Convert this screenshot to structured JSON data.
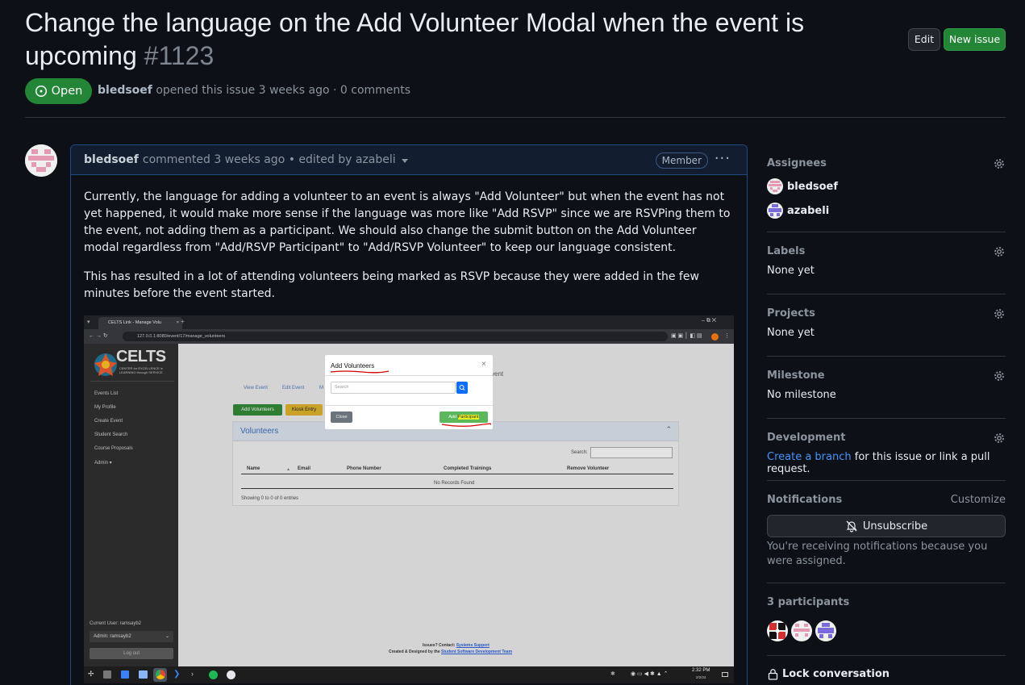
{
  "issue": {
    "title": "Change the language on the Add Volunteer Modal when the event is upcoming",
    "number": "#1123",
    "state": "Open",
    "author": "bledsoef",
    "opened_text": "opened this issue 3 weeks ago · 0 comments"
  },
  "header": {
    "edit_label": "Edit",
    "new_issue_label": "New issue"
  },
  "comment": {
    "author": "bledsoef",
    "meta": "commented 3 weeks ago • edited by azabeli",
    "badge": "Member",
    "menu": "···",
    "paragraphs": [
      "Currently, the language for adding a volunteer to an event is always \"Add Volunteer\" but when the event has not yet happened, it would make more sense if the language was more like \"Add RSVP\" since we are RSVPing them to the event, not adding them as a participant. We should also change the submit button on the Add Volunteer modal regardless from \"Add/RSVP Participant\" to \"Add/RSVP Volunteer\" to keep our language consistent.",
      "This has resulted in a lot of attending volunteers being marked as RSVP because they were added in the few minutes before the event started."
    ]
  },
  "screenshot": {
    "tab_title": "CELTS Link - Manage Volu",
    "url": "127.0.0.1:8080/event/17/manage_volunteers",
    "logo_text": "CELTS",
    "logo_sub": "CENTER for EXCELLENCE in LEARNING through SERVICE",
    "nav": [
      "Events List",
      "My Profile",
      "Create Event",
      "Student Search",
      "Course Proposals",
      "Admin ▾"
    ],
    "current_user": "Current User: ramsayb2",
    "admin_select": "Admin: ramsayb2",
    "logout": "Log out",
    "event_text": "vent",
    "links": [
      "View Event",
      "Edit Event",
      "M"
    ],
    "add_volunteers_btn": "Add Volunteers",
    "kiosk_btn": "Kiosk Entry",
    "panel_title": "Volunteers",
    "search_label": "Search:",
    "columns": [
      "Name",
      "Email",
      "Phone Number",
      "Completed Trainings",
      "Remove Volunteer"
    ],
    "no_records": "No Records Found",
    "showing": "Showing 0 to 0 of 0 entries",
    "modal_title": "Add Volunteers",
    "modal_search_placeholder": "Search",
    "modal_close": "Close",
    "modal_submit_add": "Add",
    "modal_submit_participant": "Participant",
    "footer1_label": "Issues? Contact:",
    "footer1_link": "Systems Support",
    "footer2_label": "Created & Designed by the",
    "footer2_link": "Student Software Development Team",
    "clock_time": "2:32 PM",
    "clock_date": "2/2/24"
  },
  "sidebar": {
    "assignees_heading": "Assignees",
    "assignees": [
      "bledsoef",
      "azabeli"
    ],
    "labels_heading": "Labels",
    "labels_value": "None yet",
    "projects_heading": "Projects",
    "projects_value": "None yet",
    "milestone_heading": "Milestone",
    "milestone_value": "No milestone",
    "development_heading": "Development",
    "development_link": "Create a branch",
    "development_rest": " for this issue or link a pull request.",
    "notifications_heading": "Notifications",
    "customize": "Customize",
    "unsubscribe": "Unsubscribe",
    "notif_reason": "You're receiving notifications because you were assigned.",
    "participants_heading": "3 participants",
    "lock": "Lock conversation"
  },
  "colors": {
    "background": "#0d1117",
    "open_green": "#238636",
    "link_blue": "#4493f8",
    "comment_border": "#1f4a80"
  }
}
